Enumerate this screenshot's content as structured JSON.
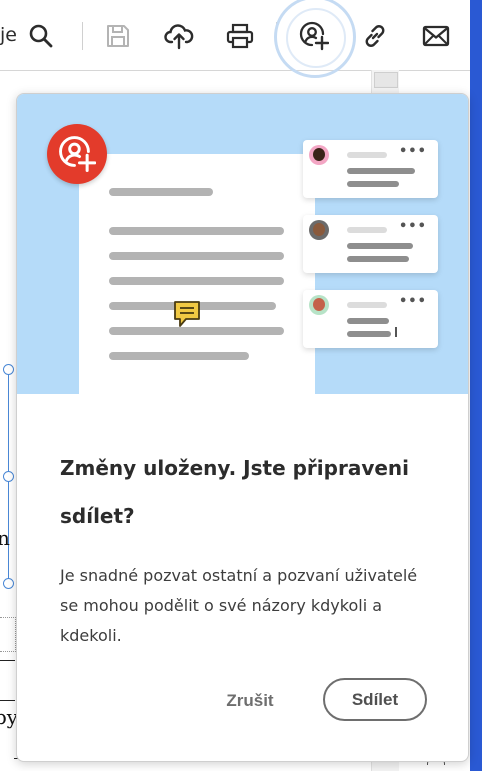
{
  "toolbar": {
    "partial_label": "je",
    "icons": [
      "search-icon",
      "save-icon",
      "upload-cloud-icon",
      "print-icon",
      "share-user-add-icon",
      "link-icon",
      "mail-icon"
    ]
  },
  "background_doc": {
    "fragment_n": "n",
    "fragment_py": "py"
  },
  "popup": {
    "title": "Změny uloženy. Jste připraveni sdílet?",
    "description": "Je snadné pozvat ostatní a pozvaní uživatelé se mohou podělit o své názory kdykoli a kdekoli.",
    "cancel_label": "Zrušit",
    "share_label": "Sdílet",
    "colors": {
      "illustration_bg": "#b5dbf9",
      "badge_red": "#e33b2b",
      "comment_yellow": "#f1c943",
      "accent_blue": "#2a59d3"
    }
  }
}
